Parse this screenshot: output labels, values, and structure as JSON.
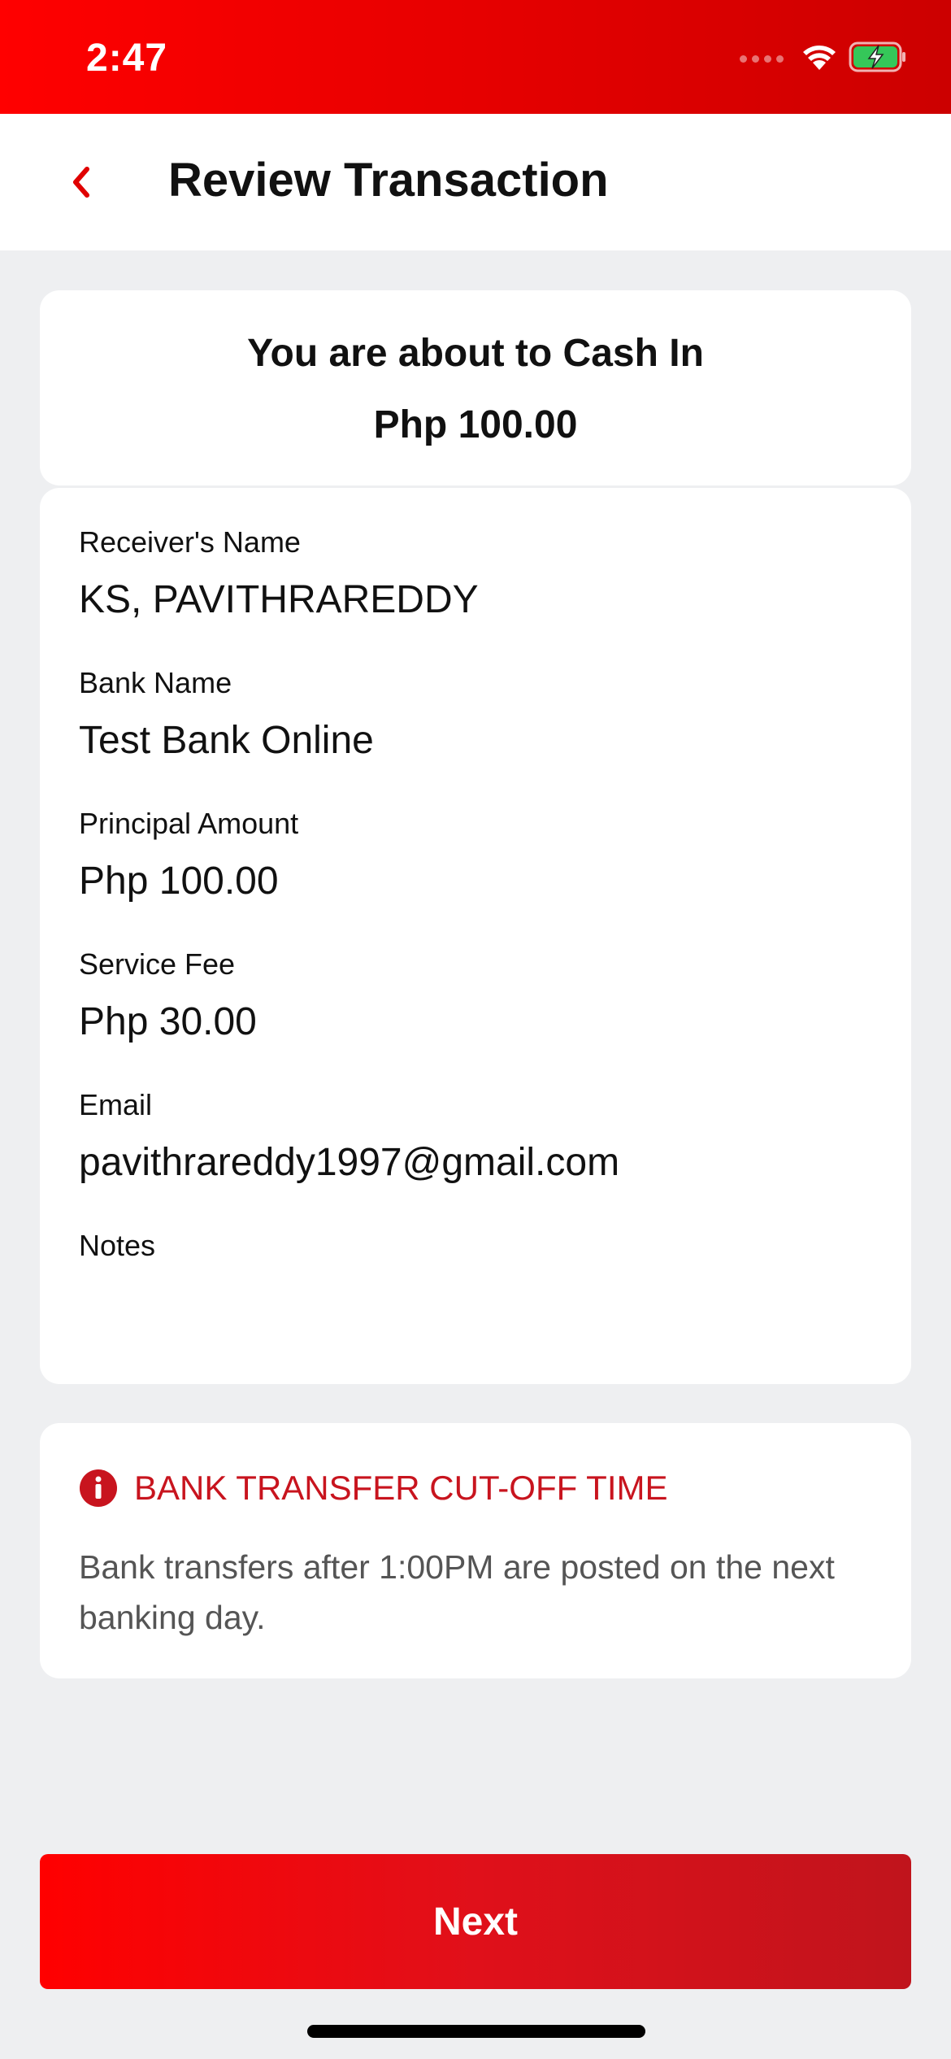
{
  "status_bar": {
    "time": "2:47",
    "icons": [
      "signal-icon",
      "wifi-icon",
      "battery-charging-icon"
    ]
  },
  "header": {
    "back_icon": "chevron-left-icon",
    "title": "Review Transaction"
  },
  "summary": {
    "line1": "You are about to Cash In",
    "amount": "Php 100.00"
  },
  "details": [
    {
      "label": "Receiver's Name",
      "value": "KS, PAVITHRAREDDY"
    },
    {
      "label": "Bank Name",
      "value": "Test Bank Online"
    },
    {
      "label": "Principal Amount",
      "value": "Php 100.00"
    },
    {
      "label": "Service Fee",
      "value": "Php 30.00"
    },
    {
      "label": "Email",
      "value": "pavithrareddy1997@gmail.com"
    },
    {
      "label": "Notes",
      "value": ""
    }
  ],
  "notice": {
    "icon": "info-icon",
    "title": "BANK TRANSFER CUT-OFF TIME",
    "body": "Bank transfers after 1:00PM are posted on the next banking day."
  },
  "footer": {
    "next_label": "Next"
  },
  "colors": {
    "brand_red": "#e60000",
    "notice_red": "#c8141e",
    "background": "#eeeff1"
  }
}
